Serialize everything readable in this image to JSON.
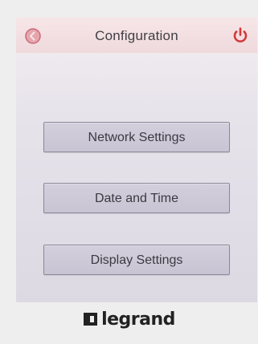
{
  "header": {
    "title": "Configuration",
    "back_icon": "back-circle-icon",
    "power_icon": "power-icon",
    "accent_color": "#d23a3a"
  },
  "menu": {
    "items": [
      {
        "label": "Network Settings"
      },
      {
        "label": "Date and Time"
      },
      {
        "label": "Display Settings"
      }
    ]
  },
  "brand": {
    "logo_text": "legrand"
  }
}
